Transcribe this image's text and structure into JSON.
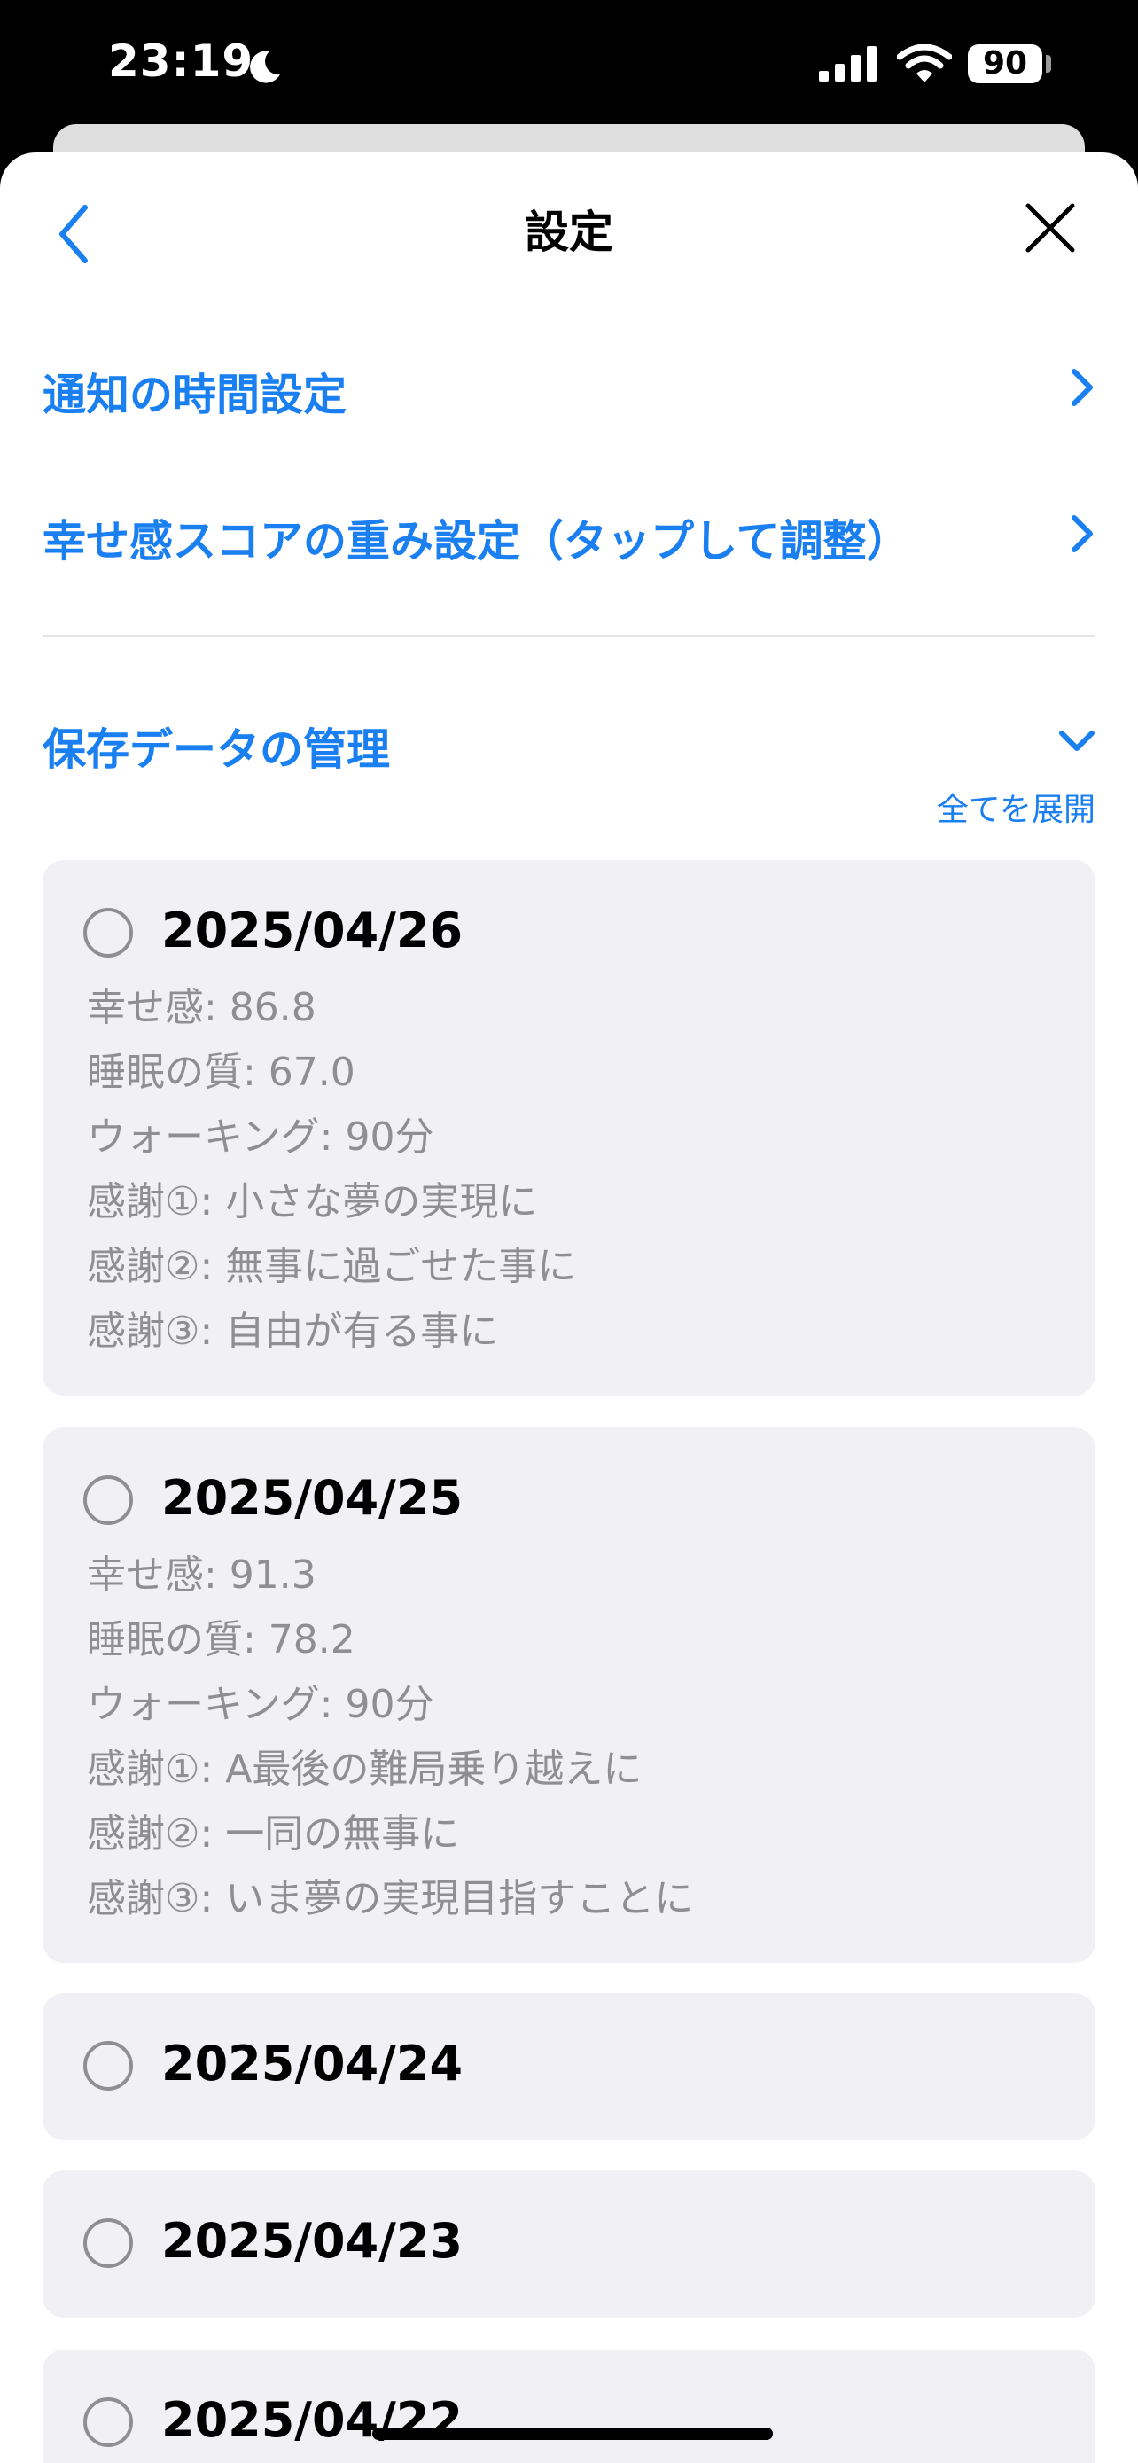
{
  "status_bar": {
    "time": "23:19",
    "battery": "90"
  },
  "nav": {
    "title": "設定"
  },
  "menu": {
    "notify_time": "通知の時間設定",
    "score_weight": "幸せ感スコアの重み設定（タップして調整）",
    "saved_data": "保存データの管理",
    "expand_all": "全てを展開"
  },
  "cards": [
    {
      "date": "2025/04/26",
      "lines": [
        "幸せ感: 86.8",
        "睡眠の質: 67.0",
        "ウォーキング: 90分",
        "感謝①: 小さな夢の実現に",
        "感謝②: 無事に過ごせた事に",
        "感謝③: 自由が有る事に"
      ]
    },
    {
      "date": "2025/04/25",
      "lines": [
        "幸せ感: 91.3",
        "睡眠の質: 78.2",
        "ウォーキング: 90分",
        "感謝①: A最後の難局乗り越えに",
        "感謝②: 一同の無事に",
        "感謝③: いま夢の実現目指すことに"
      ]
    },
    {
      "date": "2025/04/24",
      "lines": []
    },
    {
      "date": "2025/04/23",
      "lines": []
    },
    {
      "date": "2025/04/22",
      "lines": []
    }
  ],
  "colors": {
    "accent": "#1a7ff0",
    "card_bg": "#f1f1f5",
    "secondary_text": "#8e8e93"
  }
}
